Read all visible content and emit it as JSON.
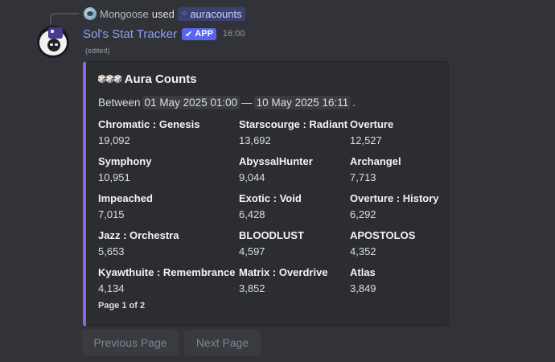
{
  "reply": {
    "user": "Mongoose",
    "used_text": "used",
    "command": "auracounts",
    "command_icon": "slash-command-icon"
  },
  "message": {
    "bot_name": "Sol's Stat Tracker",
    "app_badge": "APP",
    "badge_check": "✔",
    "timestamp": "16:00",
    "edited_label": "(edited)"
  },
  "embed": {
    "accent_color": "#8f62e6",
    "title_icon": "🎲🎲🎲",
    "title": "Aura Counts",
    "desc_prefix": "Between",
    "date_from": "01 May 2025 01:00",
    "date_sep": "—",
    "date_to": "10 May 2025 16:11",
    "desc_suffix": ".",
    "fields": [
      {
        "name": "Chromatic : Genesis",
        "value": "19,092"
      },
      {
        "name": "Starscourge : Radiant",
        "value": "13,692"
      },
      {
        "name": "Overture",
        "value": "12,527"
      },
      {
        "name": "Symphony",
        "value": "10,951"
      },
      {
        "name": "AbyssalHunter",
        "value": "9,044"
      },
      {
        "name": "Archangel",
        "value": "7,713"
      },
      {
        "name": "Impeached",
        "value": "7,015"
      },
      {
        "name": "Exotic : Void",
        "value": "6,428"
      },
      {
        "name": "Overture : History",
        "value": "6,292"
      },
      {
        "name": "Jazz : Orchestra",
        "value": "5,653"
      },
      {
        "name": "BLOODLUST",
        "value": "4,597"
      },
      {
        "name": "APOSTOLOS",
        "value": "4,352"
      },
      {
        "name": "Kyawthuite : Remembrance",
        "value": "4,134"
      },
      {
        "name": "Matrix : Overdrive",
        "value": "3,852"
      },
      {
        "name": "Atlas",
        "value": "3,849"
      }
    ],
    "footer": "Page 1 of 2"
  },
  "buttons": {
    "previous": "Previous Page",
    "next": "Next Page"
  },
  "colors": {
    "background": "#313338",
    "embed_bg": "#2b2d31",
    "bot_name": "#8ea1f2",
    "app_badge": "#5865f2"
  }
}
